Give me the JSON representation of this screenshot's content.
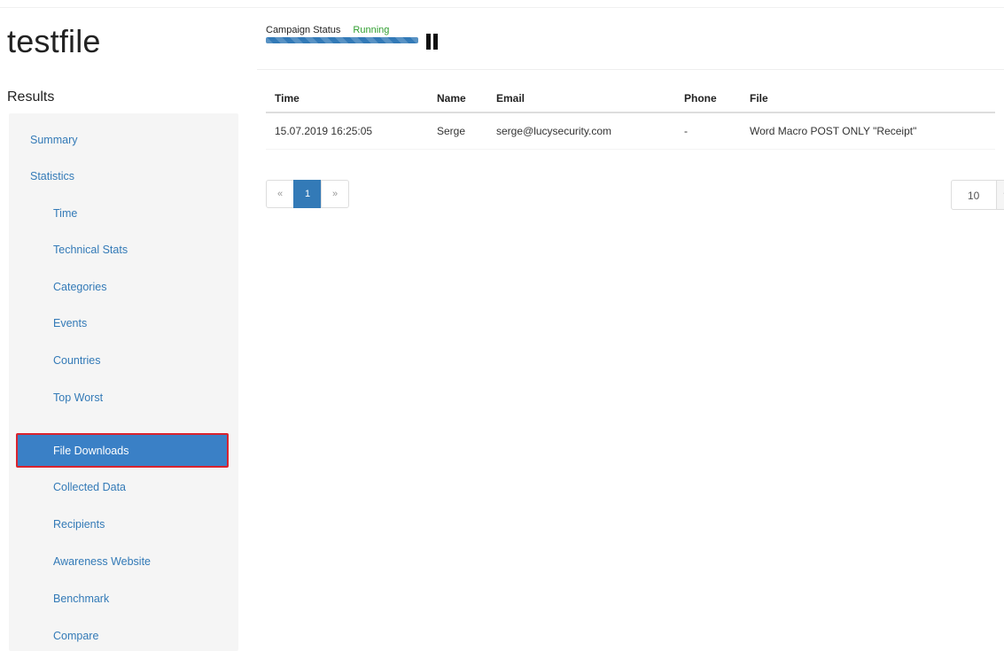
{
  "page": {
    "title": "testfile"
  },
  "campaign_status": {
    "label": "Campaign Status",
    "value": "Running",
    "pause_icon": "pause-icon",
    "status_color": "#2f9e2f",
    "bar_color": "#337ab7"
  },
  "sidebar": {
    "heading": "Results",
    "items": [
      {
        "label": "Summary"
      },
      {
        "label": "Statistics"
      },
      {
        "label": "Time"
      },
      {
        "label": "Technical Stats"
      },
      {
        "label": "Categories"
      },
      {
        "label": "Events"
      },
      {
        "label": "Countries"
      },
      {
        "label": "Top Worst"
      },
      {
        "label": "File Downloads",
        "active": true
      },
      {
        "label": "Collected Data"
      },
      {
        "label": "Recipients"
      },
      {
        "label": "Awareness Website"
      },
      {
        "label": "Benchmark"
      },
      {
        "label": "Compare"
      }
    ]
  },
  "table": {
    "columns": [
      "Time",
      "Name",
      "Email",
      "Phone",
      "File"
    ],
    "rows": [
      [
        "15.07.2019 16:25:05",
        "Serge",
        "serge@lucysecurity.com",
        "-",
        "Word Macro POST ONLY \"Receipt\""
      ]
    ]
  },
  "pagination": {
    "prev": "«",
    "pages": [
      "1"
    ],
    "current": "1",
    "next": "»",
    "page_size": "10",
    "page_size_icon": "chevron-down-icon"
  }
}
